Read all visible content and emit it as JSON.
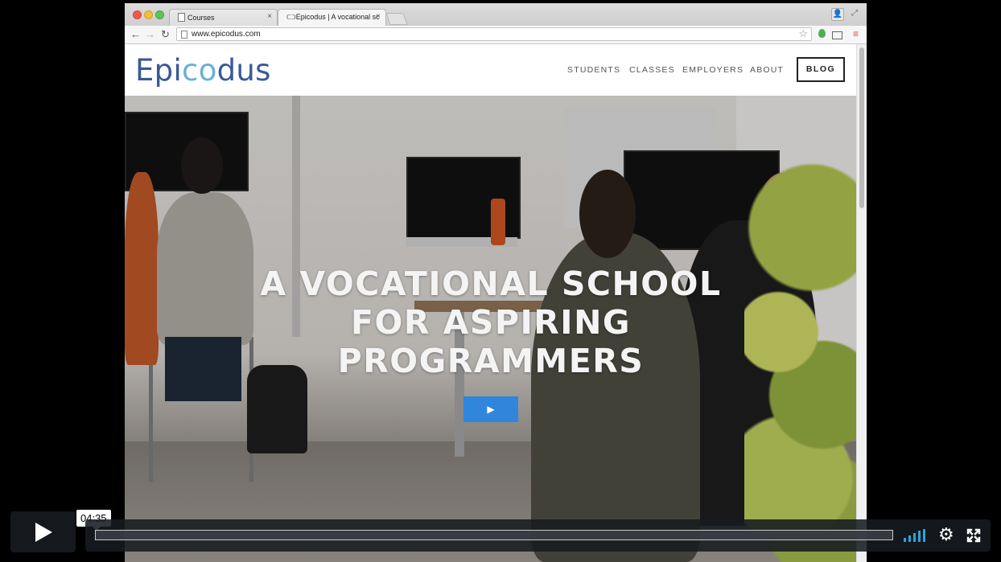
{
  "browser": {
    "tabs": [
      {
        "label": "Courses"
      },
      {
        "label": "Epicodus | A vocational sc"
      }
    ],
    "url": "www.epicodus.com"
  },
  "site": {
    "logo_prefix": "Epi",
    "logo_accent": "co",
    "logo_suffix": "dus",
    "nav": {
      "students": "STUDENTS",
      "classes": "CLASSES",
      "employers": "EMPLOYERS",
      "about": "ABOUT",
      "blog": "BLOG"
    },
    "hero": {
      "line1": "A VOCATIONAL SCHOOL",
      "line2": "FOR ASPIRING",
      "line3": "PROGRAMMERS"
    },
    "colors": {
      "logo": "#3b5998",
      "logo_accent": "#6ab0d6",
      "hero_button": "#2f86db"
    }
  },
  "player": {
    "timecode": "04:35",
    "played_fraction": 0,
    "icons": [
      "play-icon",
      "volume-icon",
      "settings-gear-icon",
      "fullscreen-icon"
    ],
    "accent": "#2aa3dc"
  }
}
